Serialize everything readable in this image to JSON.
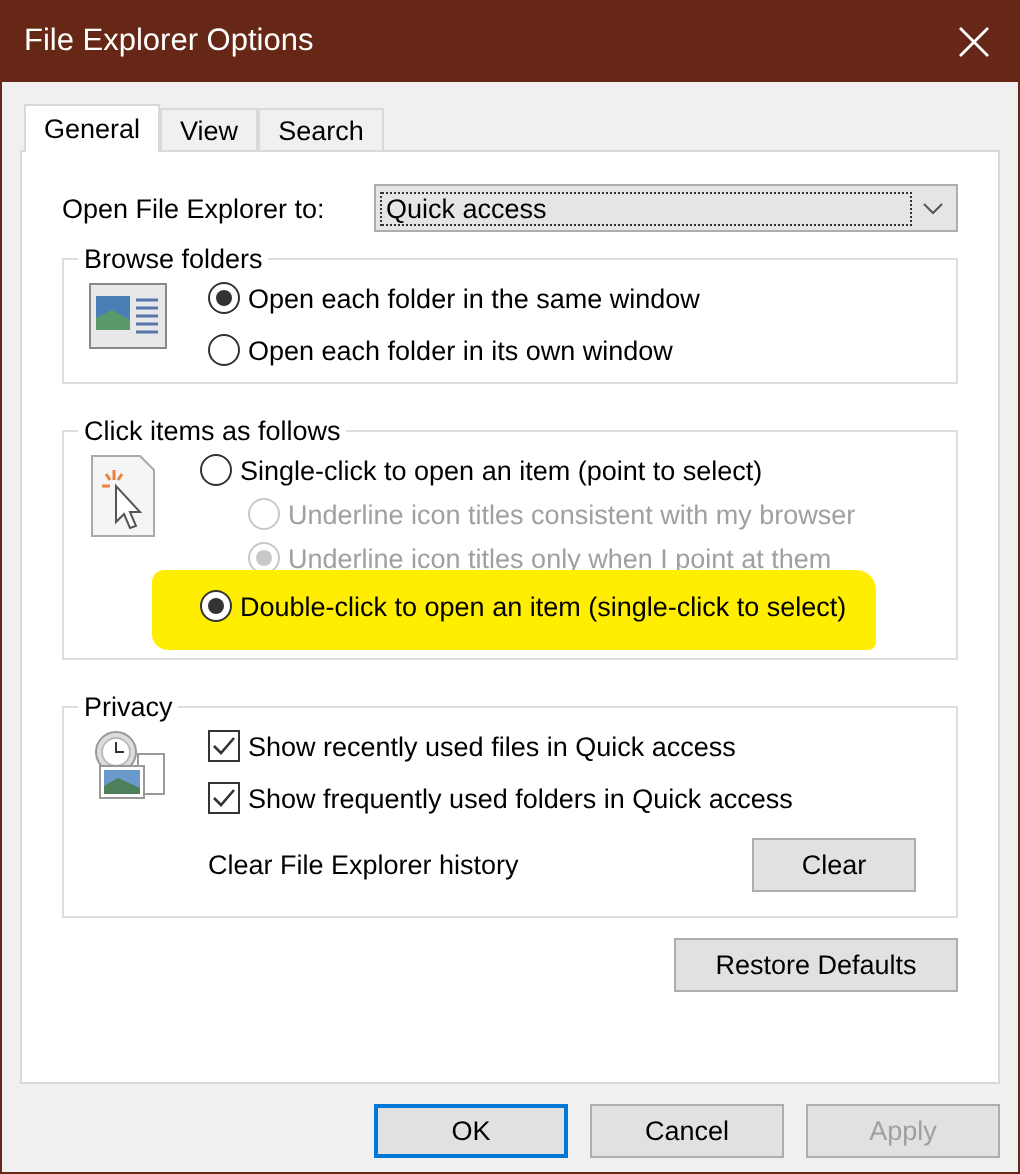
{
  "window": {
    "title": "File Explorer Options"
  },
  "tabs": [
    {
      "label": "General",
      "selected": true
    },
    {
      "label": "View",
      "selected": false
    },
    {
      "label": "Search",
      "selected": false
    }
  ],
  "open_to": {
    "label": "Open File Explorer to:",
    "value": "Quick access"
  },
  "browse_folders": {
    "title": "Browse folders",
    "options": [
      {
        "label": "Open each folder in the same window",
        "selected": true,
        "disabled": false
      },
      {
        "label": "Open each folder in its own window",
        "selected": false,
        "disabled": false
      }
    ]
  },
  "click_items": {
    "title": "Click items as follows",
    "options": [
      {
        "label": "Single-click to open an item (point to select)",
        "selected": false,
        "disabled": false,
        "highlighted": false,
        "children": [
          {
            "label": "Underline icon titles consistent with my browser",
            "selected": false,
            "disabled": true,
            "highlighted": false
          },
          {
            "label": "Underline icon titles only when I point at them",
            "selected": true,
            "disabled": true,
            "highlighted": false
          }
        ]
      },
      {
        "label": "Double-click to open an item (single-click to select)",
        "selected": true,
        "disabled": false,
        "highlighted": true
      }
    ]
  },
  "privacy": {
    "title": "Privacy",
    "checkboxes": [
      {
        "label": "Show recently used files in Quick access",
        "checked": true
      },
      {
        "label": "Show frequently used folders in Quick access",
        "checked": true
      }
    ],
    "clear_label": "Clear File Explorer history",
    "clear_button": "Clear"
  },
  "restore_button": "Restore Defaults",
  "buttons": [
    {
      "label": "OK",
      "default": true,
      "disabled": false
    },
    {
      "label": "Cancel",
      "default": false,
      "disabled": false
    },
    {
      "label": "Apply",
      "default": false,
      "disabled": true
    }
  ]
}
